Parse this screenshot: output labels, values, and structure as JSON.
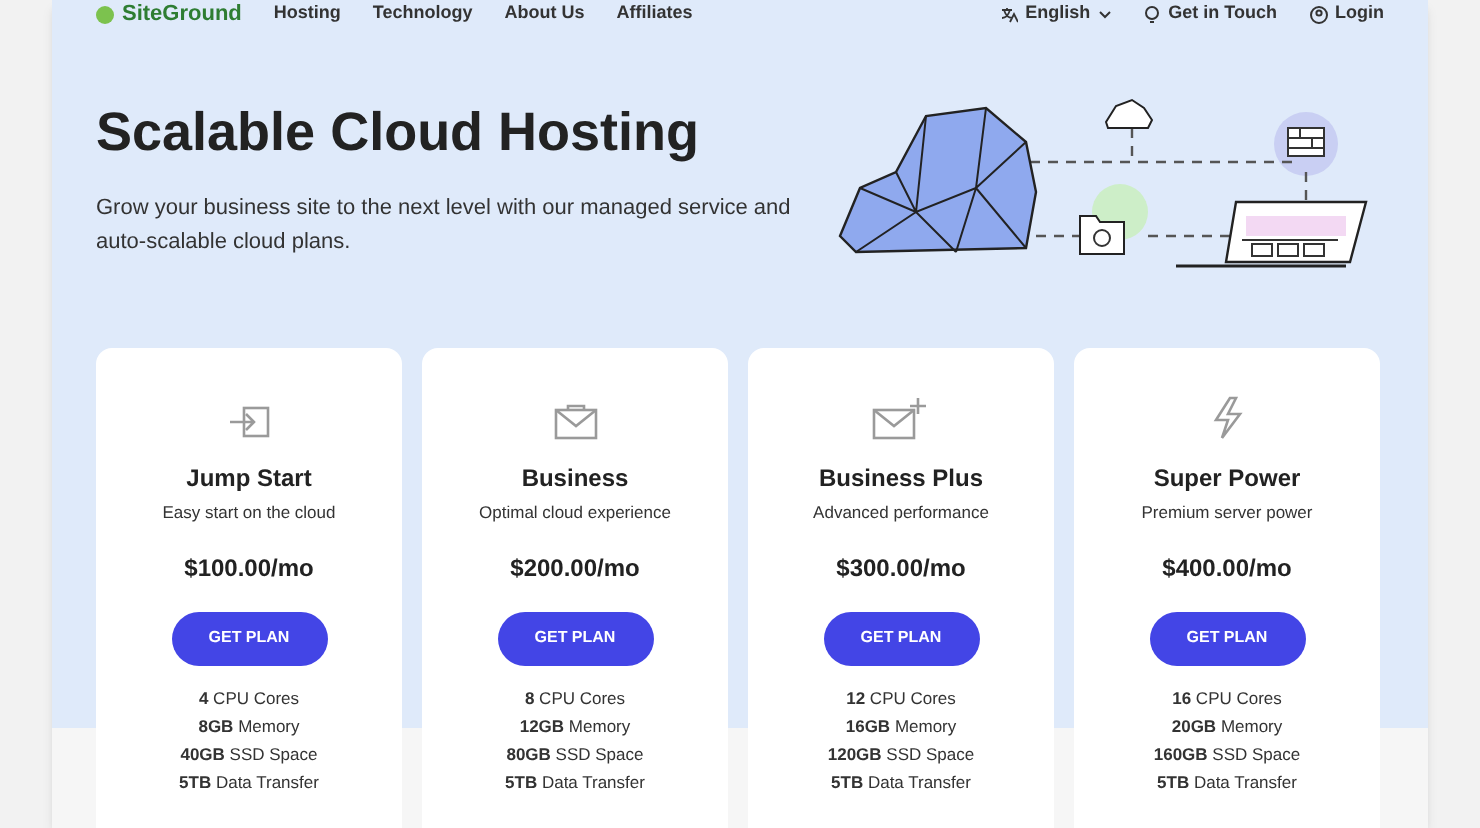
{
  "nav": {
    "logo": "SiteGround",
    "links": [
      "Hosting",
      "Technology",
      "About Us",
      "Affiliates"
    ],
    "language": "English",
    "contact": "Get in Touch",
    "login": "Login"
  },
  "hero": {
    "title": "Scalable Cloud Hosting",
    "description": "Grow your business site to the next level with our managed service and auto-scalable cloud plans."
  },
  "plans": [
    {
      "kind": "enter",
      "name": "Jump Start",
      "tagline": "Easy start on the cloud",
      "price": "$100.00/mo",
      "button": "GET PLAN",
      "features": [
        "**4** CPU Cores",
        "**8GB** Memory",
        "**40GB** SSD Space",
        "**5TB** Data Transfer"
      ]
    },
    {
      "kind": "envelope",
      "name": "Business",
      "tagline": "Optimal cloud experience",
      "price": "$200.00/mo",
      "button": "GET PLAN",
      "features": [
        "**8** CPU Cores",
        "**12GB** Memory",
        "**80GB** SSD Space",
        "**5TB** Data Transfer"
      ]
    },
    {
      "kind": "envelope-plus",
      "name": "Business Plus",
      "tagline": "Advanced performance",
      "price": "$300.00/mo",
      "button": "GET PLAN",
      "features": [
        "**12** CPU Cores",
        "**16GB** Memory",
        "**120GB** SSD Space",
        "**5TB** Data Transfer"
      ]
    },
    {
      "kind": "bolt",
      "name": "Super Power",
      "tagline": "Premium server power",
      "price": "$400.00/mo",
      "button": "GET PLAN",
      "features": [
        "**16** CPU Cores",
        "**20GB** Memory",
        "**160GB** SSD Space",
        "**5TB** Data Transfer"
      ]
    }
  ]
}
